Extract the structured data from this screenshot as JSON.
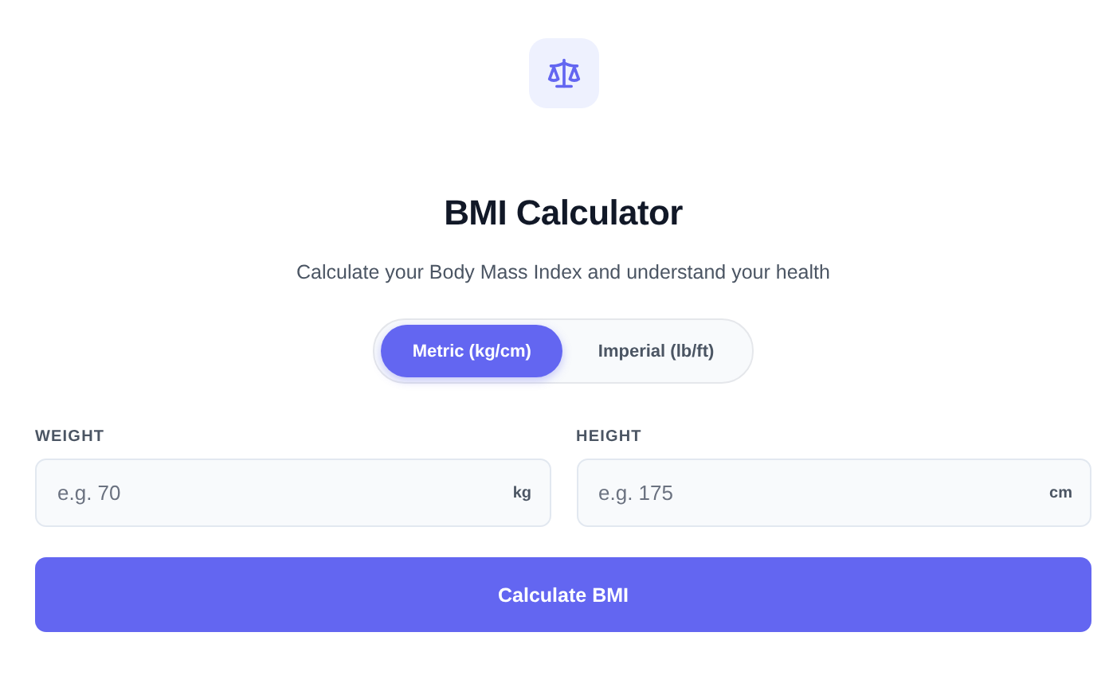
{
  "title": "BMI Calculator",
  "subtitle": "Calculate your Body Mass Index and understand your health",
  "units": [
    {
      "label": "Metric (kg/cm)",
      "selected": true
    },
    {
      "label": "Imperial (lb/ft)",
      "selected": false
    }
  ],
  "fields": [
    {
      "label": "WEIGHT",
      "placeholder": "e.g. 70",
      "unit": "kg"
    },
    {
      "label": "HEIGHT",
      "placeholder": "e.g. 175",
      "unit": "cm"
    }
  ],
  "button": "Calculate BMI"
}
